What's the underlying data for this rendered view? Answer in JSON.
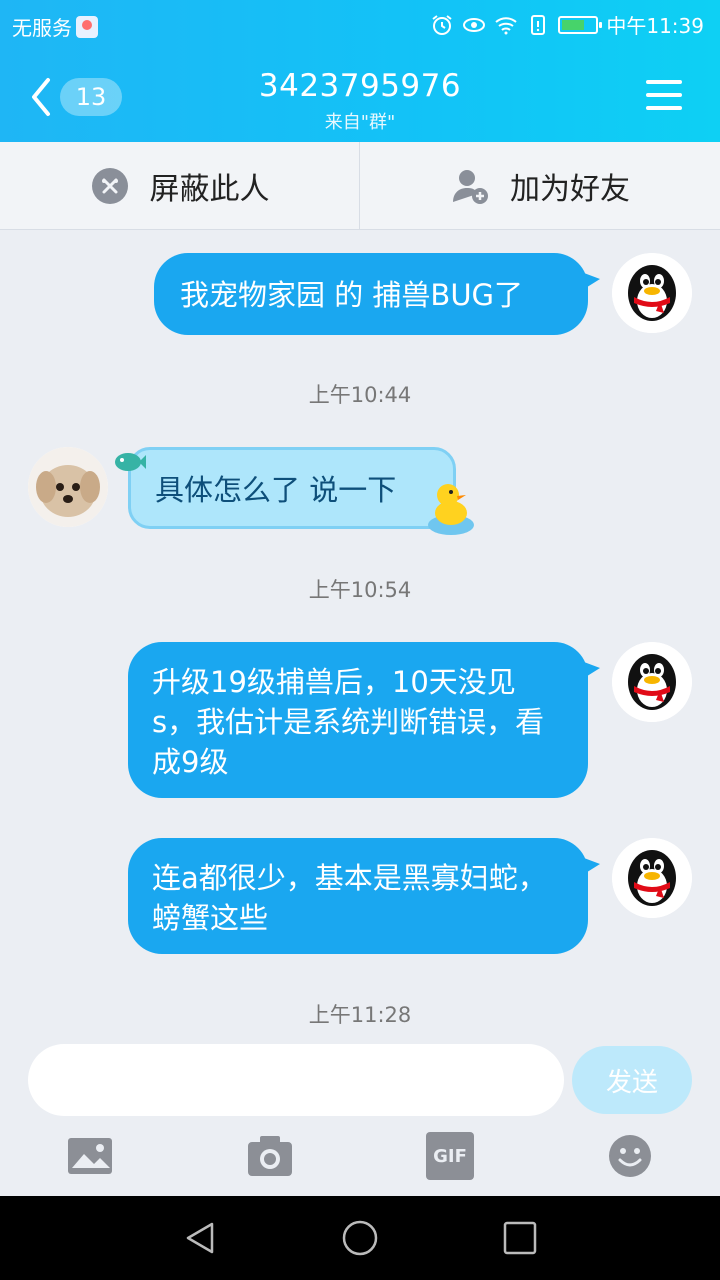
{
  "status_bar": {
    "carrier": "无服务",
    "time": "中午11:39"
  },
  "header": {
    "back_badge": "13",
    "title": "3423795976",
    "subtitle": "来自\"群\""
  },
  "actions": {
    "block": "屏蔽此人",
    "add_friend": "加为好友"
  },
  "messages": [
    {
      "side": "right",
      "text": "我宠物家园 的 捕兽BUG了"
    },
    {
      "type": "timestamp",
      "text": "上午10:44"
    },
    {
      "side": "left",
      "text": "具体怎么了 说一下"
    },
    {
      "type": "timestamp",
      "text": "上午10:54"
    },
    {
      "side": "right",
      "text": "升级19级捕兽后，10天没见s，我估计是系统判断错误，看成9级"
    },
    {
      "side": "right",
      "text": "连a都很少，基本是黑寡妇蛇，螃蟹这些"
    },
    {
      "type": "timestamp",
      "text": "上午11:28"
    }
  ],
  "input": {
    "value": "",
    "send_label": "发送"
  },
  "tools": {
    "gif_label": "GIF"
  },
  "colors": {
    "header": "#1fb6f5",
    "bubble_right": "#1aa7f0",
    "bubble_left": "#aee6fb",
    "send_button": "#bde9fb"
  }
}
